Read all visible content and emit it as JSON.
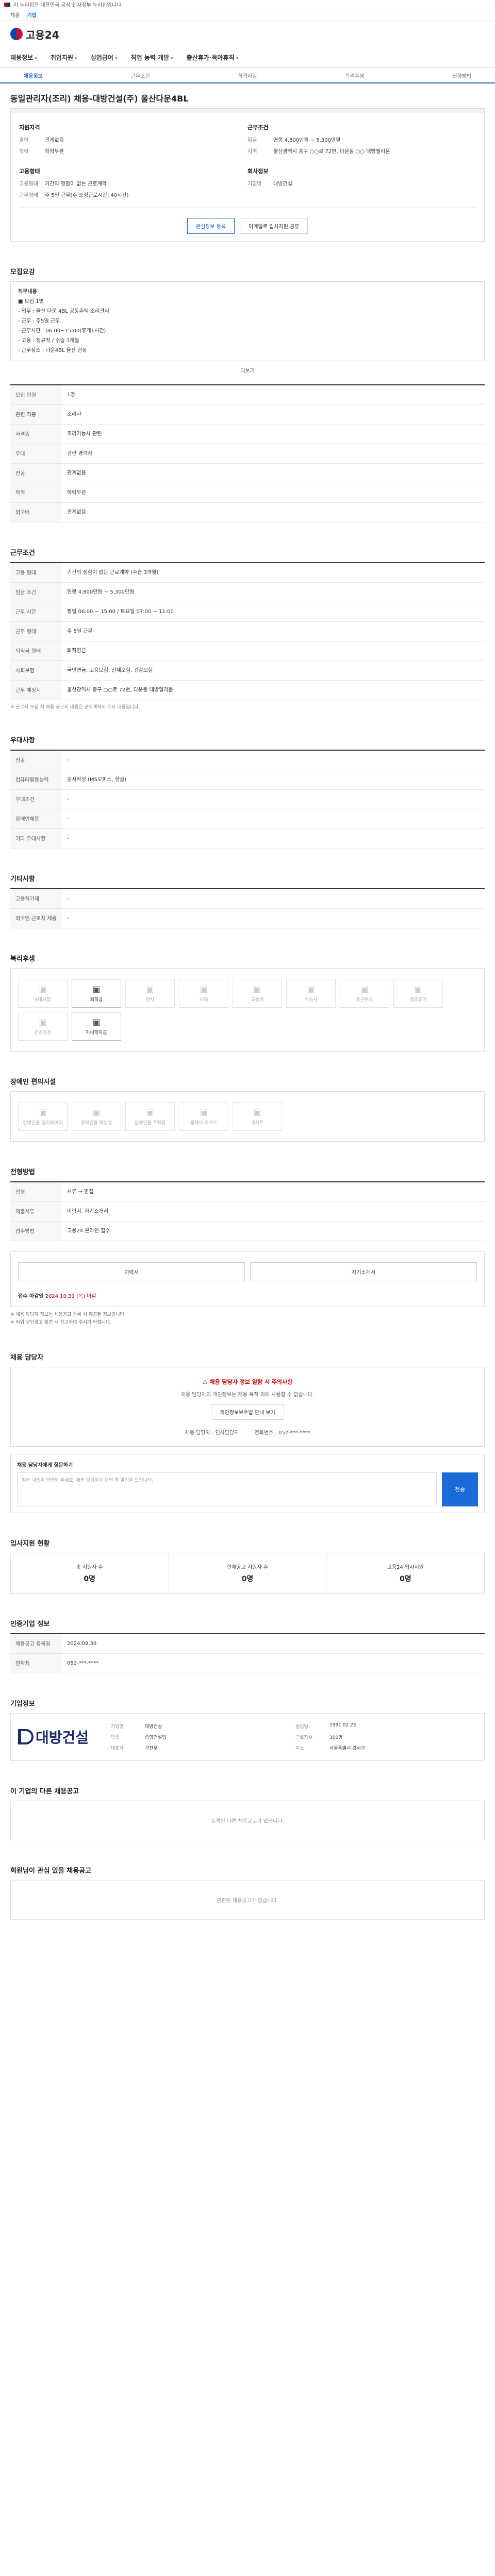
{
  "gov": {
    "notice": "이 누리집은 대한민국 공식 전자정부 누리집입니다."
  },
  "lang": [
    "채용",
    "기업"
  ],
  "logo": "고용24",
  "gnb": [
    "채용정보",
    "취업지원",
    "실업급여",
    "직업 능력 개발",
    "출산휴가·육아휴직"
  ],
  "subtabs": [
    "채용정보",
    "근무조건",
    "학력사항",
    "복리후생",
    "전형방법"
  ],
  "job": {
    "company": "대방건설",
    "title": "동일관리자(조리) 채용-대방건설(주) 울산다운4BL",
    "badge": "Y"
  },
  "summary": {
    "left_h": "지원자격",
    "left": [
      {
        "k": "경력",
        "v": "관계없음"
      },
      {
        "k": "학력",
        "v": "학력무관"
      }
    ],
    "right_h": "근무조건",
    "right": [
      {
        "k": "임금",
        "v": "연봉 4,800만원 ~ 5,300만원"
      },
      {
        "k": "지역",
        "v": "울산광역시 중구 ○○로 72번, 다운동 ○○ 대방엘리움"
      }
    ],
    "left2_h": "고용형태",
    "left2": [
      {
        "k": "고용형태",
        "v": "기간의 정함이 없는 근로계약"
      },
      {
        "k": "근무형태",
        "v": "주 5일 근무(주 소정근로시간: 40시간)"
      }
    ],
    "right2_h": "회사정보",
    "right2": [
      {
        "k": "기업명",
        "v": "대방건설"
      }
    ],
    "btn_apply": "관심정보 등록",
    "btn_share": "이메일로 입사지원 공유"
  },
  "duty": {
    "h": "모집요강",
    "body": [
      "직무내용",
      "■ 모집 1명",
      "- 업무 : 울산 다운 4BL 공동주택 조리관리",
      "- 근무 : 주5일 근무",
      "- 근무시간 : 06:00~15:00(휴게1시간)",
      "- 고용 : 정규직 / 수습 3개월",
      "- 근무장소 : 다운4BL 울산 현장"
    ],
    "more": "더보기"
  },
  "recruit": {
    "h": "모집요강",
    "rows": [
      {
        "k": "모집 인원",
        "v": "1명"
      },
      {
        "k": "관련 직종",
        "v": "조리사"
      },
      {
        "k": "자격증",
        "v": "조리기능사 관련"
      },
      {
        "k": "우대",
        "v": "관련 경력자"
      },
      {
        "k": "전공",
        "v": "관계없음"
      },
      {
        "k": "학력",
        "v": "학력무관"
      },
      {
        "k": "외국어",
        "v": "관계없음"
      }
    ]
  },
  "cond": {
    "h": "근무조건",
    "rows": [
      {
        "k": "고용 형태",
        "v": "기간의 정함이 없는 근로계약 (수습 3개월)"
      },
      {
        "k": "임금 조건",
        "v": "연봉 4,800만원 ~ 5,300만원"
      },
      {
        "k": "근무 시간",
        "v": "평일 06:00 ~ 15:00 / 토요일 07:00 ~ 11:00"
      },
      {
        "k": "근무 형태",
        "v": "주 5일 근무"
      },
      {
        "k": "퇴직금 형태",
        "v": "퇴직연금"
      },
      {
        "k": "사회보험",
        "v": "국민연금, 고용보험, 산재보험, 건강보험"
      },
      {
        "k": "근무 예정지",
        "v": "울산광역시 중구 ○○로 72번, 다운동 대방엘리움"
      }
    ],
    "note": "※ 근로자 모집 시 채용 공고의 내용은 근로계약의 주요 내용입니다."
  },
  "etc": {
    "h": "우대사항",
    "rows": [
      {
        "k": "전공",
        "v": "-"
      },
      {
        "k": "컴퓨터활용능력",
        "v": "문서작성 (MS오피스, 한글)"
      },
      {
        "k": "우대조건",
        "v": "-"
      },
      {
        "k": "장애인채용",
        "v": "-"
      },
      {
        "k": "기타 우대사항",
        "v": "-"
      }
    ]
  },
  "skill": {
    "h": "기타사항",
    "rows": [
      {
        "k": "고용허가제",
        "v": "-"
      },
      {
        "k": "외국인 근로자 채용",
        "v": "-"
      }
    ]
  },
  "welfare": {
    "h": "복리후생",
    "items": [
      "4대보험",
      "퇴직금",
      "연차",
      "식대",
      "교통비",
      "기숙사",
      "통근버스",
      "경조휴가",
      "건강검진",
      "자녀학자금"
    ],
    "on": [
      1,
      9
    ]
  },
  "disabled": {
    "h": "장애인 편의시설",
    "items": [
      "장애인용 엘리베이터",
      "장애인용 화장실",
      "장애인용 주차장",
      "휠체어 리프트",
      "경사로"
    ]
  },
  "apply": {
    "h": "전형방법",
    "rows": [
      {
        "k": "전형",
        "v": "서류 → 면접"
      },
      {
        "k": "제출서류",
        "v": "이력서, 자기소개서"
      },
      {
        "k": "접수방법",
        "v": "고용24 온라인 접수"
      }
    ],
    "btn1": "이력서",
    "btn2": "자기소개서",
    "deadline_k": "접수 마감일",
    "deadline": "2024.10.31 (목) 마감"
  },
  "warn": [
    "※ 채용 담당자 정보는 채용공고 등록 시 제공된 정보입니다.",
    "※ 허위 구인광고 발견 시 신고하여 주시기 바랍니다."
  ],
  "manager": {
    "h": "채용 담당자",
    "alert": "채용 담당자 정보 열람 시 주의사항",
    "alert_body": "채용 담당자의 개인정보는 채용 목적 외에 사용할 수 없습니다.",
    "btn": "개인정보보호법 안내 보기",
    "name_k": "채용 담당자",
    "name": "인사담당자",
    "phone_k": "전화번호",
    "phone": "052-***-****"
  },
  "inquiry": {
    "h": "채용 담당자에게 질문하기",
    "placeholder": "질문 내용을 입력해 주세요. 채용 담당자가 답변 후 알림을 드립니다.",
    "send": "전송"
  },
  "stats": {
    "h": "입사지원 현황",
    "items": [
      {
        "k": "총 지원자 수",
        "v": "0명"
      },
      {
        "k": "현재공고 지원자 수",
        "v": "0명"
      },
      {
        "k": "고용24 입사지원",
        "v": "0명"
      }
    ]
  },
  "info": {
    "h": "인증기업 정보",
    "rows": [
      {
        "k": "채용공고 등록일",
        "v": "2024.09.30"
      },
      {
        "k": "연락처",
        "v": "052-***-****"
      }
    ]
  },
  "corp": {
    "h": "기업정보",
    "logo": "대방건설",
    "rows": [
      {
        "k": "기업명",
        "v": "대방건설"
      },
      {
        "k": "설립일",
        "v": "1991.02.23"
      },
      {
        "k": "업종",
        "v": "종합건설업"
      },
      {
        "k": "근로자수",
        "v": "300명"
      },
      {
        "k": "대표자",
        "v": "구찬우"
      },
      {
        "k": "주소",
        "v": "서울특별시 강서구"
      }
    ]
  },
  "other": {
    "h": "이 기업의 다른 채용공고",
    "empty": "등록된 다른 채용공고가 없습니다."
  },
  "similar": {
    "h": "회원님이 관심 있을 채용공고",
    "empty": "관련된 채용공고가 없습니다."
  }
}
